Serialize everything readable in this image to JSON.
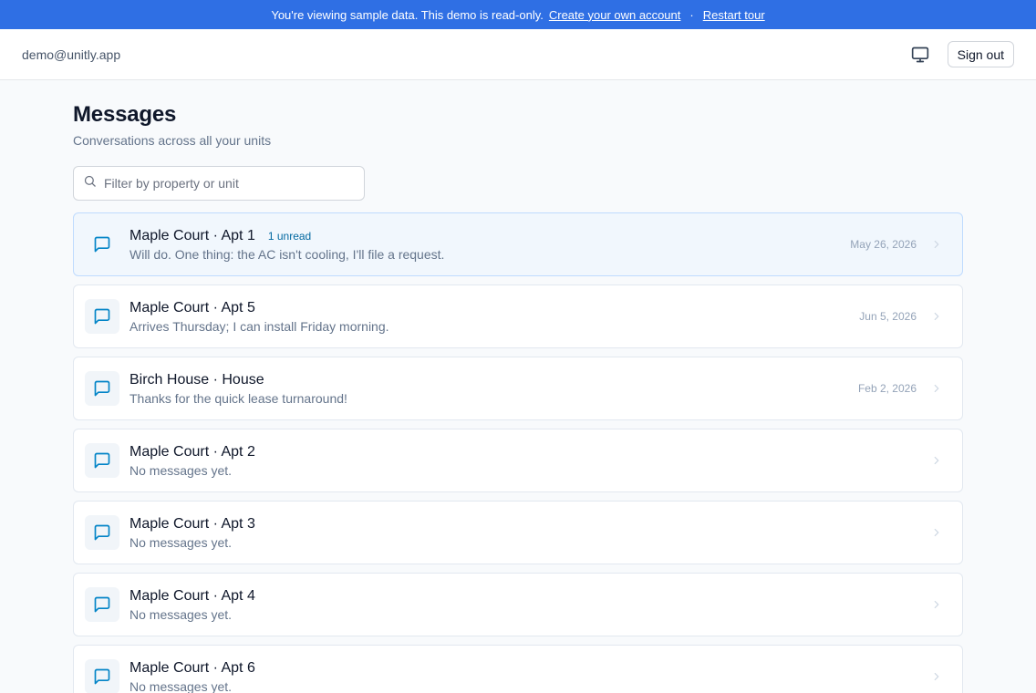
{
  "banner": {
    "text": "You're viewing sample data. This demo is read-only.",
    "create_link": "Create your own account",
    "separator": "·",
    "restart_link": "Restart tour",
    "bg_color": "#2f6fe4"
  },
  "header": {
    "email": "demo@unitly.app",
    "display_icon": "monitor-icon",
    "signout_label": "Sign out"
  },
  "page": {
    "title": "Messages",
    "subtitle": "Conversations across all your units",
    "search_placeholder": "Filter by property or unit",
    "search_value": ""
  },
  "conversations": [
    {
      "name": "Maple Court · Apt 1",
      "badge": "1 unread",
      "preview": "Will do. One thing: the AC isn't cooling, I'll file a request.",
      "date": "May 26, 2026",
      "unread": true
    },
    {
      "name": "Maple Court · Apt 5",
      "badge": "",
      "preview": "Arrives Thursday; I can install Friday morning.",
      "date": "Jun 5, 2026",
      "unread": false
    },
    {
      "name": "Birch House · House",
      "badge": "",
      "preview": "Thanks for the quick lease turnaround!",
      "date": "Feb 2, 2026",
      "unread": false
    },
    {
      "name": "Maple Court · Apt 2",
      "badge": "",
      "preview": "No messages yet.",
      "date": "",
      "unread": false
    },
    {
      "name": "Maple Court · Apt 3",
      "badge": "",
      "preview": "No messages yet.",
      "date": "",
      "unread": false
    },
    {
      "name": "Maple Court · Apt 4",
      "badge": "",
      "preview": "No messages yet.",
      "date": "",
      "unread": false
    },
    {
      "name": "Maple Court · Apt 6",
      "badge": "",
      "preview": "No messages yet.",
      "date": "",
      "unread": false
    }
  ],
  "colors": {
    "accent_icon": "#0284c7",
    "badge_text": "#0369a1"
  }
}
